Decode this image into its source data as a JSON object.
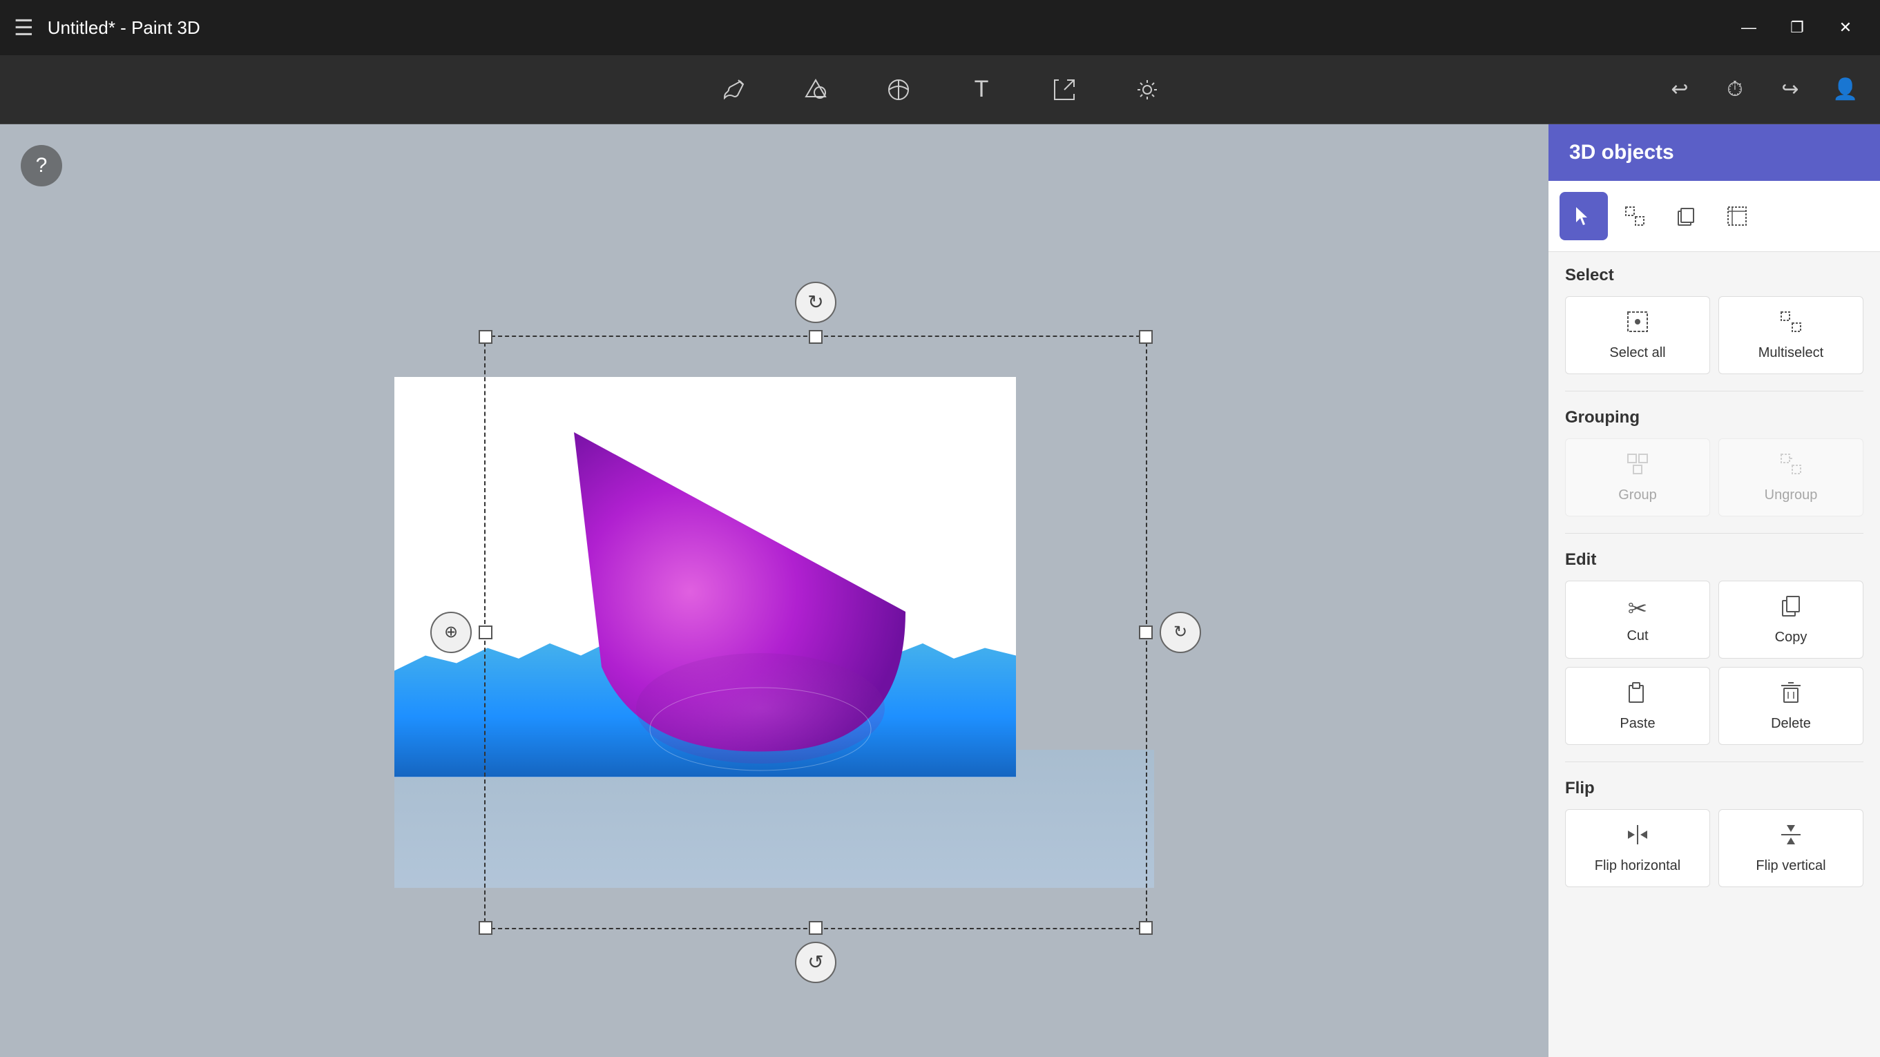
{
  "titleBar": {
    "title": "Untitled* - Paint 3D",
    "controls": {
      "minimize": "—",
      "maximize": "❐",
      "close": "✕"
    }
  },
  "toolbar": {
    "hamburger": "☰",
    "tools": [
      {
        "name": "brush",
        "icon": "✏",
        "label": "Brushes",
        "active": false
      },
      {
        "name": "3d",
        "icon": "⬡",
        "label": "3D shapes",
        "active": false
      },
      {
        "name": "stickers",
        "icon": "◎",
        "label": "Stickers",
        "active": false
      },
      {
        "name": "text",
        "icon": "T",
        "label": "Text",
        "active": false
      },
      {
        "name": "canvas",
        "icon": "⤢",
        "label": "Canvas",
        "active": false
      },
      {
        "name": "effects",
        "icon": "✦",
        "label": "Effects",
        "active": false
      }
    ],
    "rightTools": {
      "undo": "↩",
      "history": "⏱",
      "redo": "↪",
      "profile": "👤"
    }
  },
  "panel": {
    "title": "3D objects",
    "toolbarIcons": [
      {
        "name": "select",
        "icon": "↖",
        "active": true
      },
      {
        "name": "multibox",
        "icon": "⊞",
        "active": false
      },
      {
        "name": "copy3d",
        "icon": "❐",
        "active": false
      },
      {
        "name": "crop",
        "icon": "⊡",
        "active": false
      }
    ],
    "sections": {
      "select": {
        "title": "Select",
        "buttons": [
          {
            "name": "select-all",
            "icon": "⊟",
            "label": "Select all",
            "disabled": false
          },
          {
            "name": "multiselect",
            "icon": "⊞",
            "label": "Multiselect",
            "disabled": false
          }
        ]
      },
      "grouping": {
        "title": "Grouping",
        "buttons": [
          {
            "name": "group",
            "icon": "⊞",
            "label": "Group",
            "disabled": true
          },
          {
            "name": "ungroup",
            "icon": "⊠",
            "label": "Ungroup",
            "disabled": true
          }
        ]
      },
      "edit": {
        "title": "Edit",
        "buttons": [
          {
            "name": "cut",
            "icon": "✂",
            "label": "Cut",
            "disabled": false
          },
          {
            "name": "copy",
            "icon": "❐",
            "label": "Copy",
            "disabled": false
          },
          {
            "name": "paste",
            "icon": "📋",
            "label": "Paste",
            "disabled": false
          },
          {
            "name": "delete",
            "icon": "🗑",
            "label": "Delete",
            "disabled": false
          }
        ]
      },
      "flip": {
        "title": "Flip",
        "buttons": [
          {
            "name": "flip-h",
            "icon": "⇔",
            "label": "Flip horizontal",
            "disabled": false
          },
          {
            "name": "flip-v",
            "icon": "⇕",
            "label": "Flip vertical",
            "disabled": false
          }
        ]
      }
    }
  }
}
